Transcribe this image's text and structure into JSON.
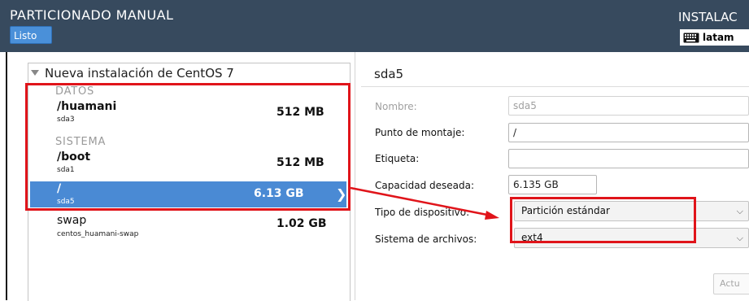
{
  "header": {
    "title": "PARTICIONADO MANUAL",
    "done_label": "Listo",
    "installer_title": "INSTALAC",
    "keyboard_layout": "latam",
    "keyboard_icon": "keyboard-icon",
    "bg_color": "#374a5e",
    "button_color": "#4a90d9"
  },
  "sidebar": {
    "install_label": "Nueva instalación de CentOS 7",
    "groups": [
      {
        "label": "DATOS",
        "items": [
          {
            "mount": "/huamani",
            "device": "sda3",
            "size": "512 MB"
          }
        ]
      },
      {
        "label": "SISTEMA",
        "items": [
          {
            "mount": "/boot",
            "device": "sda1",
            "size": "512 MB"
          },
          {
            "mount": "/",
            "device": "sda5",
            "size": "6.13 GB",
            "selected": true
          }
        ]
      }
    ],
    "other": {
      "mount": "swap",
      "device": "centos_huamani-swap",
      "size": "1.02 GB"
    },
    "selection_color": "#4a8ad4"
  },
  "detail": {
    "title": "sda5",
    "name_label": "Nombre:",
    "name_value": "sda5",
    "mount_label": "Punto de montaje:",
    "mount_value": "/",
    "tag_label": "Etiqueta:",
    "tag_value": "",
    "capacity_label": "Capacidad deseada:",
    "capacity_value": "6.135 GB",
    "device_type_label": "Tipo de dispositivo:",
    "device_type_value": "Partición estándar",
    "filesystem_label": "Sistema de archivos:",
    "filesystem_value": "ext4",
    "update_label": "Actu"
  },
  "annotations": {
    "highlight_color": "#e0141a"
  }
}
